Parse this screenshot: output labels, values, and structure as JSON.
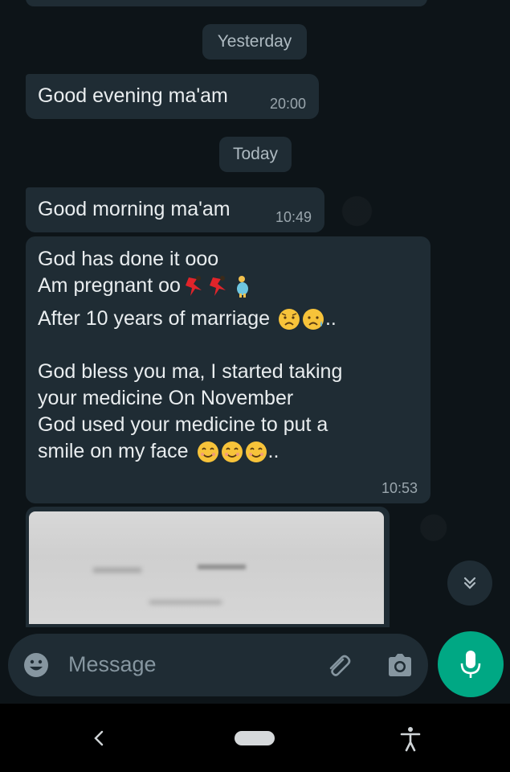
{
  "chat": {
    "date_yesterday": "Yesterday",
    "date_today": "Today",
    "messages": [
      {
        "text": "Good evening ma'am",
        "time": "20:00"
      },
      {
        "text": "Good morning ma'am",
        "time": "10:49"
      }
    ],
    "long_message": {
      "line1": "God has done it ooo",
      "line2": "Am pregnant oo",
      "line3": "After 10 years of marriage",
      "line3_suffix": "..",
      "line4": "God bless you ma, I started taking",
      "line5": "your medicine On November",
      "line6": "God used your medicine to put a",
      "line7": "smile on my face",
      "line7_suffix": "..",
      "time": "10:53"
    }
  },
  "composer": {
    "placeholder": "Message"
  },
  "icons": {
    "emoji": "emoji-icon",
    "attach": "paperclip-icon",
    "camera": "camera-icon",
    "mic": "mic-icon",
    "scroll_down": "double-chevron-down-icon",
    "nav_back": "back-chevron-icon",
    "nav_home": "home-pill-icon",
    "accessibility": "accessibility-icon"
  },
  "colors": {
    "accent": "#00a884",
    "bubble": "#1f2c34",
    "background": "#0b141a"
  }
}
